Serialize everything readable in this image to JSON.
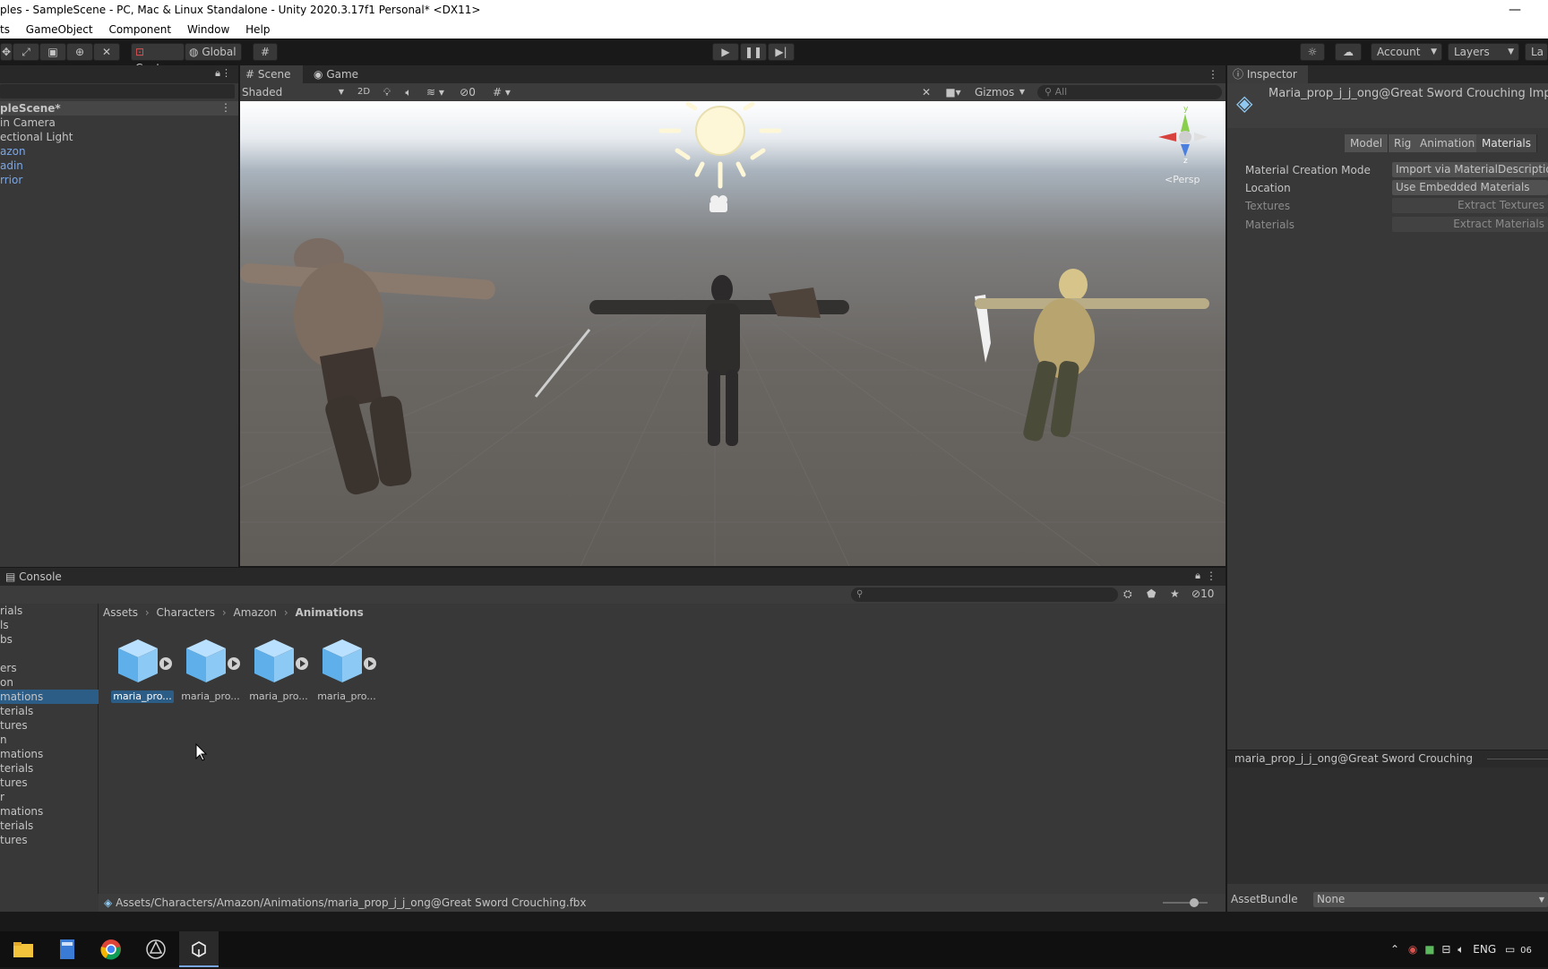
{
  "window": {
    "title": "ples - SampleScene - PC, Mac & Linux Standalone - Unity 2020.3.17f1 Personal* <DX11>",
    "minimize_glyph": "—"
  },
  "menu": [
    "ts",
    "GameObject",
    "Component",
    "Window",
    "Help"
  ],
  "toolbar": {
    "center_label": "Center",
    "global_label": "Global",
    "account_label": "Account",
    "layers_label": "Layers",
    "layout_label": "La"
  },
  "hierarchy": {
    "scene_name": "pleScene*",
    "items": [
      {
        "label": "in Camera",
        "blue": false
      },
      {
        "label": "ectional Light",
        "blue": false
      },
      {
        "label": "azon",
        "blue": true
      },
      {
        "label": "adin",
        "blue": true
      },
      {
        "label": "rrior",
        "blue": true
      }
    ]
  },
  "scene": {
    "tab_scene": "Scene",
    "tab_game": "Game",
    "shading_mode": "Shaded",
    "mode_2d": "2D",
    "hidden_count": "0",
    "gizmos_label": "Gizmos",
    "search_placeholder": "All",
    "persp_label": "Persp",
    "axis_y": "y",
    "axis_z": "z"
  },
  "inspector": {
    "tab_title": "Inspector",
    "asset_title": "Maria_prop_j_j_ong@Great Sword Crouching Import",
    "tabs": [
      "Model",
      "Rig",
      "Animation",
      "Materials"
    ],
    "active_tab": "Materials",
    "rows": [
      {
        "label": "Material Creation Mode",
        "value": "Import via MaterialDescription",
        "disabled": false
      },
      {
        "label": "Location",
        "value": "Use Embedded Materials",
        "disabled": false
      },
      {
        "label": "Textures",
        "value": "Extract Textures",
        "disabled": true
      },
      {
        "label": "Materials",
        "value": "Extract Materials",
        "disabled": true
      }
    ],
    "preview_title": "maria_prop_j_j_ong@Great Sword Crouching",
    "assetbundle_label": "AssetBundle",
    "assetbundle_value": "None"
  },
  "console": {
    "tab_label": "Console",
    "hidden_count": "10"
  },
  "project": {
    "breadcrumb": [
      "Assets",
      "Characters",
      "Amazon",
      "Animations"
    ],
    "tree": [
      {
        "label": "rials",
        "sel": false
      },
      {
        "label": "ls",
        "sel": false
      },
      {
        "label": "bs",
        "sel": false
      },
      {
        "label": "",
        "sel": false
      },
      {
        "label": "ers",
        "sel": false
      },
      {
        "label": "on",
        "sel": false
      },
      {
        "label": "mations",
        "sel": true
      },
      {
        "label": "terials",
        "sel": false
      },
      {
        "label": "tures",
        "sel": false
      },
      {
        "label": "n",
        "sel": false
      },
      {
        "label": "mations",
        "sel": false
      },
      {
        "label": "terials",
        "sel": false
      },
      {
        "label": "tures",
        "sel": false
      },
      {
        "label": "r",
        "sel": false
      },
      {
        "label": "mations",
        "sel": false
      },
      {
        "label": "terials",
        "sel": false
      },
      {
        "label": "tures",
        "sel": false
      }
    ],
    "assets": [
      {
        "label": "maria_pro...",
        "sel": true
      },
      {
        "label": "maria_pro...",
        "sel": false
      },
      {
        "label": "maria_pro...",
        "sel": false
      },
      {
        "label": "maria_pro...",
        "sel": false
      }
    ],
    "status_path": "Assets/Characters/Amazon/Animations/maria_prop_j_j_ong@Great Sword Crouching.fbx"
  },
  "taskbar": {
    "lang": "ENG",
    "clock": "06"
  }
}
